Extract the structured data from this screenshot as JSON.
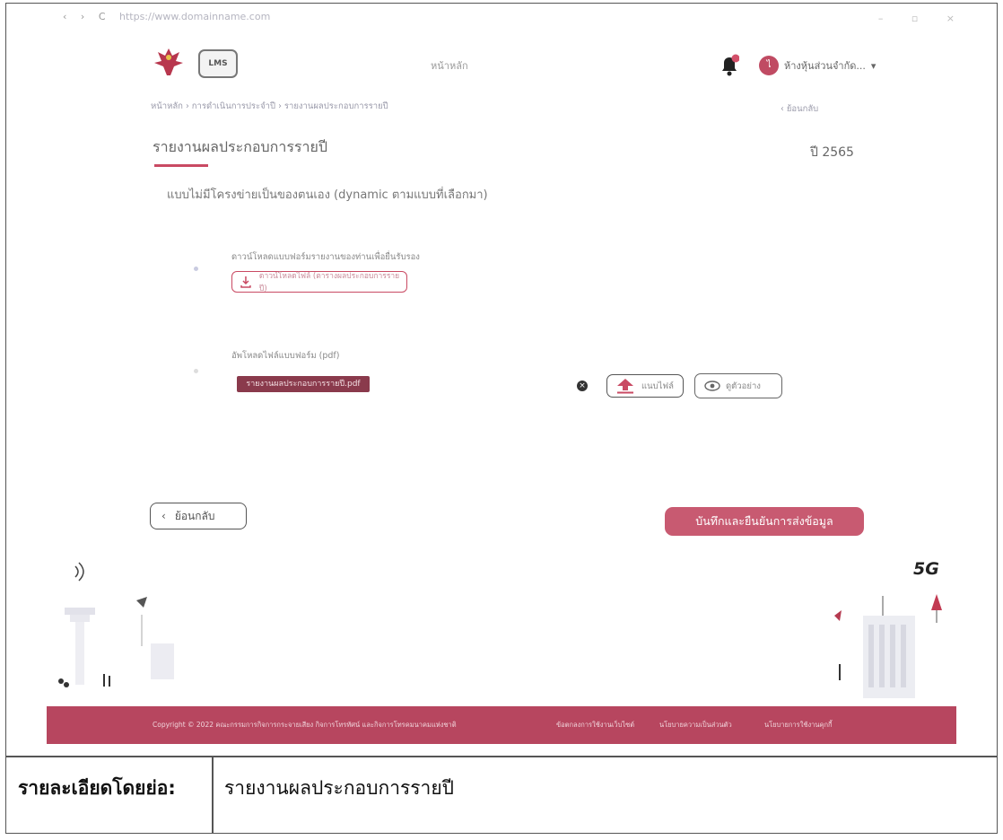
{
  "browser": {
    "nav": [
      "‹",
      "›",
      "C"
    ],
    "url": "https://www.domainname.com",
    "window_controls": "– ▫ ×"
  },
  "header": {
    "logo2_text": "LMS",
    "center_label": "หน้าหลัก",
    "user_name": "ห้างหุ้นส่วนจำกัด...",
    "user_initial": "ไ"
  },
  "breadcrumb": "หน้าหลัก  ›  การดำเนินการประจำปี  ›  รายงานผลประกอบการรายปี",
  "back_link": "‹  ย้อนกลับ",
  "page": {
    "title": "รายงานผลประกอบการรายปี",
    "year": "ปี 2565",
    "subtitle": "แบบไม่มีโครงข่ายเป็นของตนเอง (dynamic ตามแบบที่เลือกมา)"
  },
  "download": {
    "label": "ดาวน์โหลดแบบฟอร์มรายงานของท่านเพื่อยื่นรับรอง",
    "button": "ดาวน์โหลดไฟล์ (ตารางผลประกอบการรายปี)"
  },
  "upload": {
    "label": "อัพโหลดไฟล์แบบฟอร์ม (pdf)",
    "file_name": "รายงานผลประกอบการรายปี.pdf",
    "attach_button": "แนบไฟล์",
    "preview_button": "ดูตัวอย่าง"
  },
  "actions": {
    "back_button": "ย้อนกลับ",
    "save_button": "บันทึกและยืนยันการส่งข้อมูล"
  },
  "footer": {
    "copyright": "Copyright ©  2022 คณะกรรมการกิจการกระจายเสียง กิจการโทรทัศน์ และกิจการโทรคมนาคมแห่งชาติ",
    "links": [
      "ข้อตกลงการใช้งานเว็บไซต์",
      "นโยบายความเป็นส่วนตัว",
      "นโยบายการใช้งานคุกกี้"
    ]
  },
  "illustration": {
    "label_5g": "5G"
  },
  "caption": {
    "label": "รายละเอียดโดยย่อ:",
    "value": "รายงานผลประกอบการรายปี"
  },
  "colors": {
    "accent": "#c94a63",
    "footer_bg": "#b7465f",
    "save_button": "#c85a71"
  }
}
